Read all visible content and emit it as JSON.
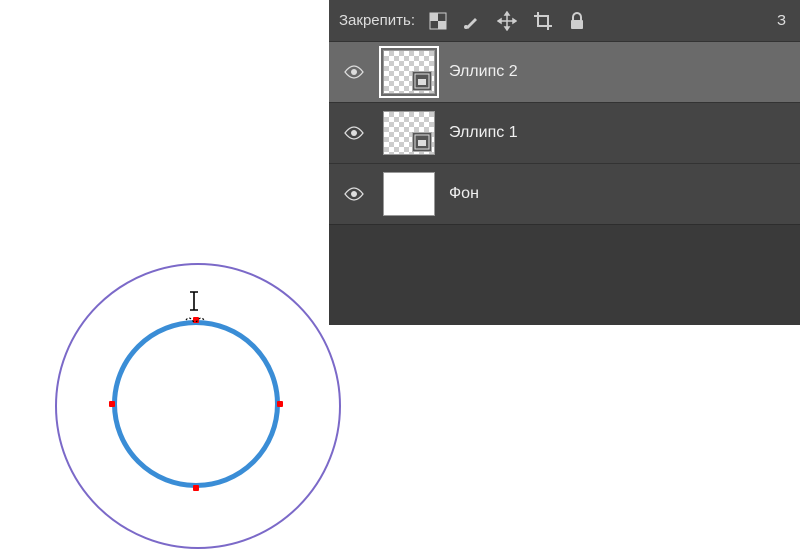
{
  "lock_bar": {
    "label": "Закрепить:",
    "right_text": "З",
    "icons": [
      "pixels-icon",
      "brush-icon",
      "move-icon",
      "crop-icon",
      "lock-icon"
    ]
  },
  "layers": [
    {
      "name": "Эллипс 2",
      "visible": true,
      "selected": true,
      "type": "shape",
      "thumb": "checker"
    },
    {
      "name": "Эллипс 1",
      "visible": true,
      "selected": false,
      "type": "shape",
      "thumb": "checker"
    },
    {
      "name": "Фон",
      "visible": true,
      "selected": false,
      "type": "bg",
      "thumb": "white"
    }
  ],
  "canvas": {
    "outer_ellipse_color": "#7b69c8",
    "inner_ellipse_color": "#3a8dd6",
    "anchor_color": "#f00"
  }
}
